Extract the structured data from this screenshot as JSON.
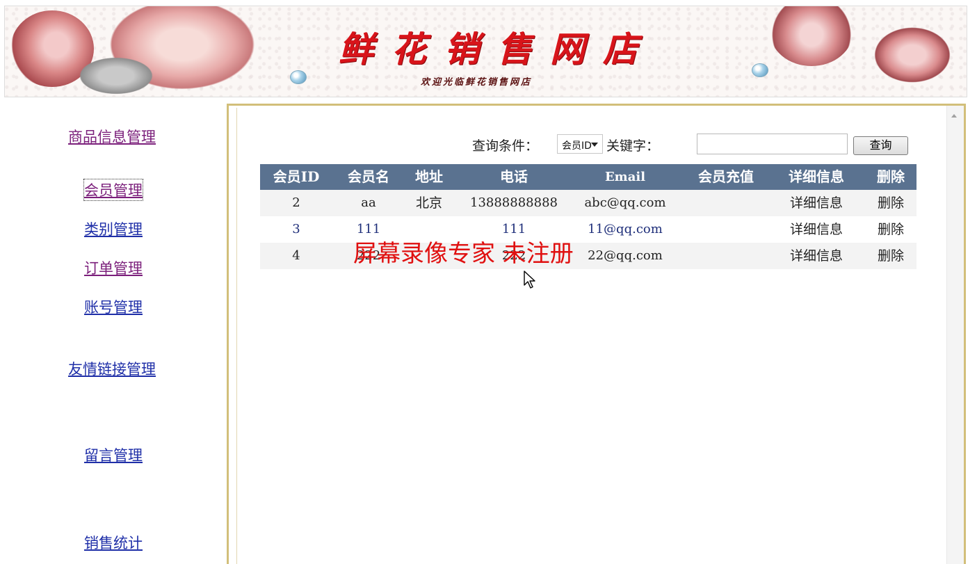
{
  "banner": {
    "title": "鲜花销售网店",
    "subtitle": "欢迎光临鲜花销售网店"
  },
  "sidebar": {
    "items": [
      {
        "label": "商品信息管理"
      },
      {
        "label": "会员管理"
      },
      {
        "label": "类别管理"
      },
      {
        "label": "订单管理"
      },
      {
        "label": "账号管理"
      },
      {
        "label": "友情链接管理"
      },
      {
        "label": "留言管理"
      },
      {
        "label": "销售统计"
      }
    ]
  },
  "search": {
    "condition_label": "查询条件：",
    "selected_option": "会员ID",
    "keyword_label": "关键字：",
    "keyword_value": "",
    "button_label": "查询"
  },
  "table": {
    "headers": [
      "会员ID",
      "会员名",
      "地址",
      "电话",
      "Email",
      "会员充值",
      "详细信息",
      "删除"
    ],
    "rows": [
      {
        "id": "2",
        "name": "aa",
        "address": "北京",
        "phone": "13888888888",
        "email": "abc@qq.com",
        "recharge": "",
        "detail": "详细信息",
        "delete": "删除"
      },
      {
        "id": "3",
        "name": "111",
        "address": "",
        "phone": "111",
        "email": "11@qq.com",
        "recharge": "",
        "detail": "详细信息",
        "delete": "删除"
      },
      {
        "id": "4",
        "name": "222",
        "address": "",
        "phone": "222",
        "email": "22@qq.com",
        "recharge": "",
        "detail": "详细信息",
        "delete": "删除"
      }
    ]
  },
  "watermark": "屏幕录像专家 未注册",
  "colors": {
    "header_bg": "#5a7290",
    "frame_border": "#d2bf7a",
    "title_red": "#d8141a",
    "link_blue": "#1f2fa8",
    "link_visited": "#7b1f7b"
  }
}
